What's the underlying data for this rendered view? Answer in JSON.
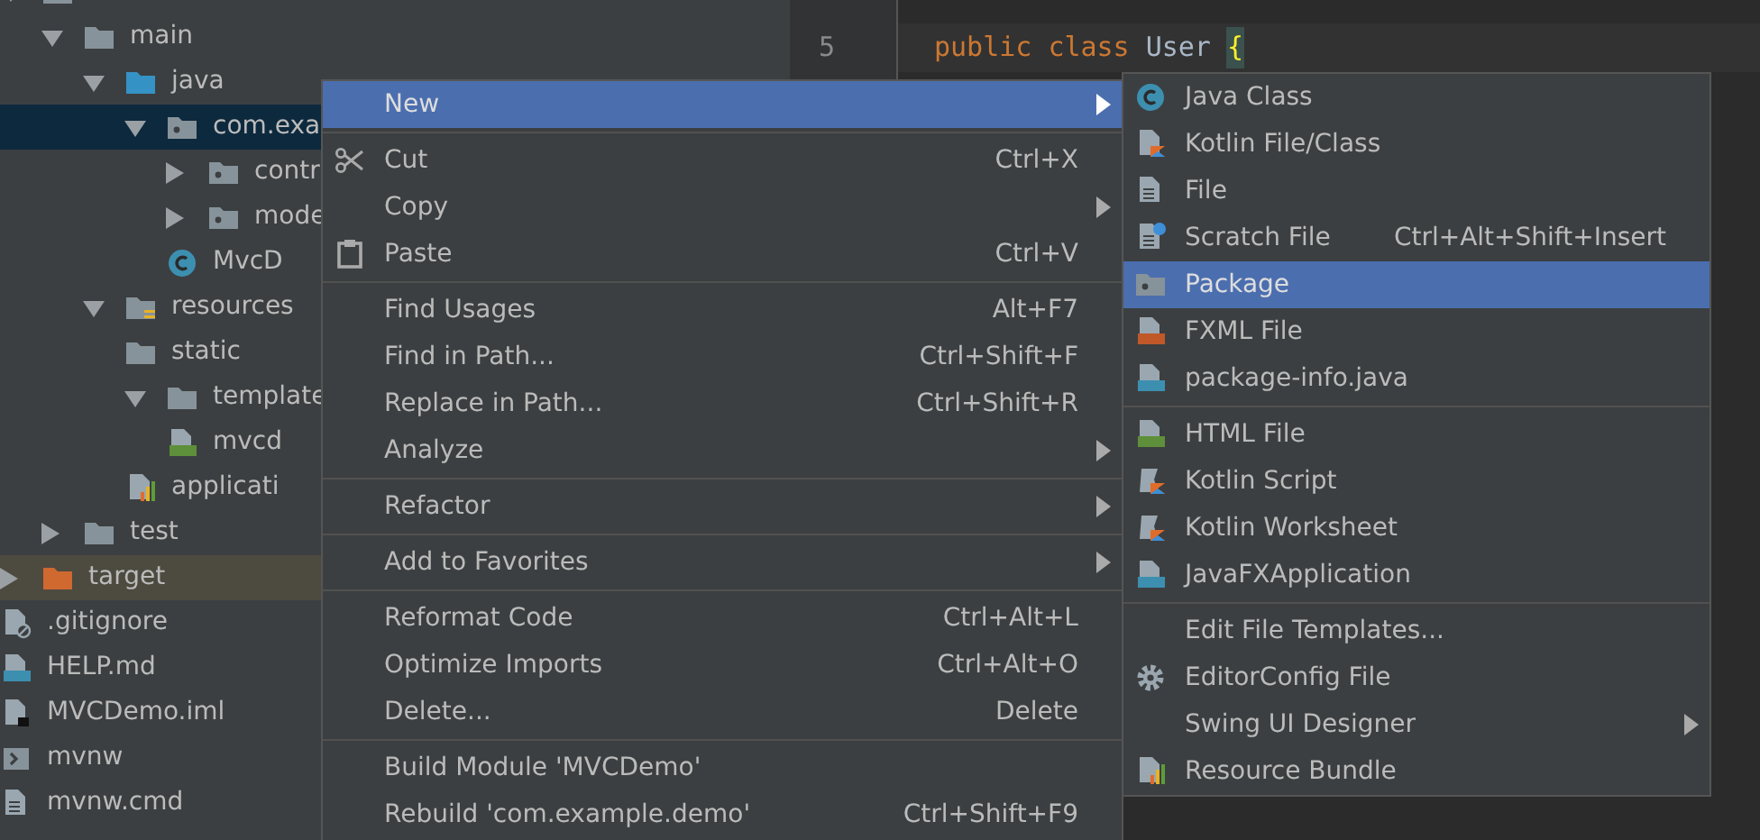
{
  "project_tree": [
    {
      "expanded": true,
      "selected": false,
      "kind": "folder",
      "children": [
        {
          "label": "main",
          "kind": "folder",
          "expanded": true,
          "selected": false,
          "children": [
            {
              "label": "java",
              "kind": "source-folder",
              "expanded": true,
              "selected": false,
              "children": [
                {
                  "label": "com.exa",
                  "kind": "package",
                  "expanded": true,
                  "selected": true,
                  "children": [
                    {
                      "label": "contr",
                      "kind": "package",
                      "expanded": false,
                      "selected": false
                    },
                    {
                      "label": "mode",
                      "kind": "package",
                      "expanded": false,
                      "selected": false
                    },
                    {
                      "label": "MvcD",
                      "kind": "java-class",
                      "selected": false
                    }
                  ]
                }
              ]
            },
            {
              "label": "resources",
              "kind": "resources-folder",
              "expanded": true,
              "selected": false,
              "children": [
                {
                  "label": "static",
                  "kind": "folder",
                  "selected": false
                },
                {
                  "label": "template",
                  "kind": "folder",
                  "expanded": true,
                  "selected": false,
                  "children": [
                    {
                      "label": "mvcd",
                      "kind": "html-file",
                      "selected": false
                    }
                  ]
                },
                {
                  "label": "applicati",
                  "kind": "properties-file",
                  "selected": false
                }
              ]
            }
          ]
        },
        {
          "label": "test",
          "kind": "folder",
          "expanded": false,
          "selected": false
        }
      ]
    },
    {
      "label": "target",
      "kind": "excluded-folder",
      "expanded": false,
      "selected": false
    },
    {
      "label": ".gitignore",
      "kind": "ignore-file",
      "selected": false
    },
    {
      "label": "HELP.md",
      "kind": "md-file",
      "selected": false
    },
    {
      "label": "MVCDemo.iml",
      "kind": "iml-file",
      "selected": false
    },
    {
      "label": "mvnw",
      "kind": "shell-file",
      "selected": false
    },
    {
      "label": "mvnw.cmd",
      "kind": "text-file",
      "selected": false
    }
  ],
  "editor": {
    "line_number": "5",
    "code": [
      {
        "text": "public",
        "kind": "keyword"
      },
      {
        "text": "class",
        "kind": "keyword"
      },
      {
        "text": "User",
        "kind": "identifier"
      },
      {
        "text": "{",
        "kind": "brace"
      }
    ]
  },
  "context_menu": [
    {
      "kind": "item",
      "label": "New",
      "selected": true,
      "has_submenu": true
    },
    {
      "kind": "separator"
    },
    {
      "kind": "item",
      "label": "Cut",
      "shortcut": "Ctrl+X",
      "selected": false,
      "has_submenu": false
    },
    {
      "kind": "item",
      "label": "Copy",
      "selected": false,
      "has_submenu": true
    },
    {
      "kind": "item",
      "label": "Paste",
      "shortcut": "Ctrl+V",
      "selected": false,
      "has_submenu": false
    },
    {
      "kind": "separator"
    },
    {
      "kind": "item",
      "label": "Find Usages",
      "shortcut": "Alt+F7",
      "selected": false,
      "has_submenu": false
    },
    {
      "kind": "item",
      "label": "Find in Path...",
      "shortcut": "Ctrl+Shift+F",
      "selected": false,
      "has_submenu": false
    },
    {
      "kind": "item",
      "label": "Replace in Path...",
      "shortcut": "Ctrl+Shift+R",
      "selected": false,
      "has_submenu": false
    },
    {
      "kind": "item",
      "label": "Analyze",
      "selected": false,
      "has_submenu": true
    },
    {
      "kind": "separator"
    },
    {
      "kind": "item",
      "label": "Refactor",
      "selected": false,
      "has_submenu": true
    },
    {
      "kind": "separator"
    },
    {
      "kind": "item",
      "label": "Add to Favorites",
      "selected": false,
      "has_submenu": true
    },
    {
      "kind": "separator"
    },
    {
      "kind": "item",
      "label": "Reformat Code",
      "shortcut": "Ctrl+Alt+L",
      "selected": false,
      "has_submenu": false
    },
    {
      "kind": "item",
      "label": "Optimize Imports",
      "shortcut": "Ctrl+Alt+O",
      "selected": false,
      "has_submenu": false
    },
    {
      "kind": "item",
      "label": "Delete...",
      "shortcut": "Delete",
      "selected": false,
      "has_submenu": false
    },
    {
      "kind": "separator"
    },
    {
      "kind": "item",
      "label": "Build Module 'MVCDemo'",
      "selected": false,
      "has_submenu": false
    },
    {
      "kind": "item",
      "label": "Rebuild 'com.example.demo'",
      "shortcut": "Ctrl+Shift+F9",
      "selected": false,
      "has_submenu": false
    }
  ],
  "new_submenu": [
    {
      "kind": "item",
      "label": "Java Class",
      "selected": false,
      "has_submenu": false
    },
    {
      "kind": "item",
      "label": "Kotlin File/Class",
      "selected": false,
      "has_submenu": false
    },
    {
      "kind": "item",
      "label": "File",
      "selected": false,
      "has_submenu": false
    },
    {
      "kind": "item",
      "label": "Scratch File",
      "shortcut": "Ctrl+Alt+Shift+Insert",
      "selected": false,
      "has_submenu": false
    },
    {
      "kind": "item",
      "label": "Package",
      "selected": true,
      "has_submenu": false
    },
    {
      "kind": "item",
      "label": "FXML File",
      "selected": false,
      "has_submenu": false
    },
    {
      "kind": "item",
      "label": "package-info.java",
      "selected": false,
      "has_submenu": false
    },
    {
      "kind": "separator"
    },
    {
      "kind": "item",
      "label": "HTML File",
      "selected": false,
      "has_submenu": false
    },
    {
      "kind": "item",
      "label": "Kotlin Script",
      "selected": false,
      "has_submenu": false
    },
    {
      "kind": "item",
      "label": "Kotlin Worksheet",
      "selected": false,
      "has_submenu": false
    },
    {
      "kind": "item",
      "label": "JavaFXApplication",
      "selected": false,
      "has_submenu": false
    },
    {
      "kind": "separator"
    },
    {
      "kind": "item",
      "label": "Edit File Templates...",
      "selected": false,
      "has_submenu": false
    },
    {
      "kind": "item",
      "label": "EditorConfig File",
      "selected": false,
      "has_submenu": false
    },
    {
      "kind": "item",
      "label": "Swing UI Designer",
      "selected": false,
      "has_submenu": true
    },
    {
      "kind": "item",
      "label": "Resource Bundle",
      "selected": false,
      "has_submenu": false
    }
  ]
}
